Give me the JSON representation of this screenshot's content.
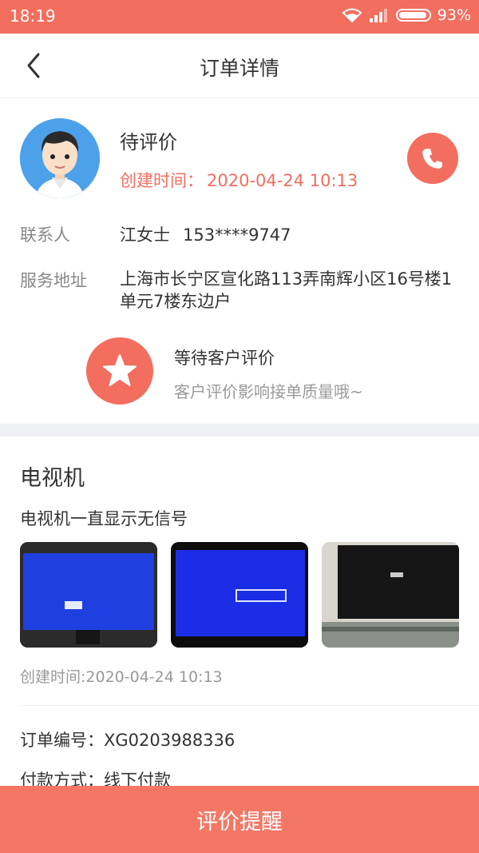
{
  "status_bar": {
    "time": "18:19",
    "battery": "93%"
  },
  "nav": {
    "title": "订单详情"
  },
  "order": {
    "status": "待评价",
    "created_label": "创建时间：",
    "created_time": "2020-04-24 10:13"
  },
  "contact": {
    "label": "联系人",
    "name": "江女士",
    "phone": "153****9747"
  },
  "address": {
    "label": "服务地址",
    "value": "上海市长宁区宣化路113弄南辉小区16号楼1单元7楼东边户"
  },
  "evaluation": {
    "title": "等待客户评价",
    "subtitle": "客户评价影响接单质量哦~"
  },
  "product": {
    "name": "电视机",
    "issue": "电视机一直显示无信号",
    "created": "创建时间:2020-04-24 10:13"
  },
  "details": {
    "order_no": "订单编号：XG0203988336",
    "payment": "付款方式：线下付款"
  },
  "action": {
    "remind_label": "评价提醒"
  },
  "colors": {
    "accent": "#f36e5f",
    "button": "#f47766"
  },
  "icons": [
    "wifi-icon",
    "signal-icon",
    "battery-icon",
    "back-arrow-icon",
    "phone-icon",
    "star-icon"
  ]
}
